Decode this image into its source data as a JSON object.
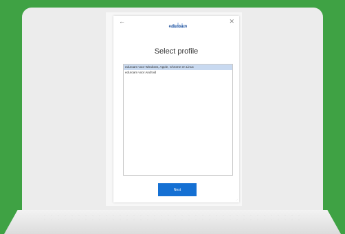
{
  "dialog": {
    "back_icon": "←",
    "close_icon": "✕",
    "logo_text": "eduroam",
    "title": "Select profile",
    "profiles": [
      {
        "label": "eduroam voor Windows, Apple, Chrome en Linux",
        "selected": true
      },
      {
        "label": "eduroam voor Android",
        "selected": false
      }
    ],
    "next_label": "Next",
    "accent_color": "#1570d3"
  },
  "background_color": "#3fa244"
}
